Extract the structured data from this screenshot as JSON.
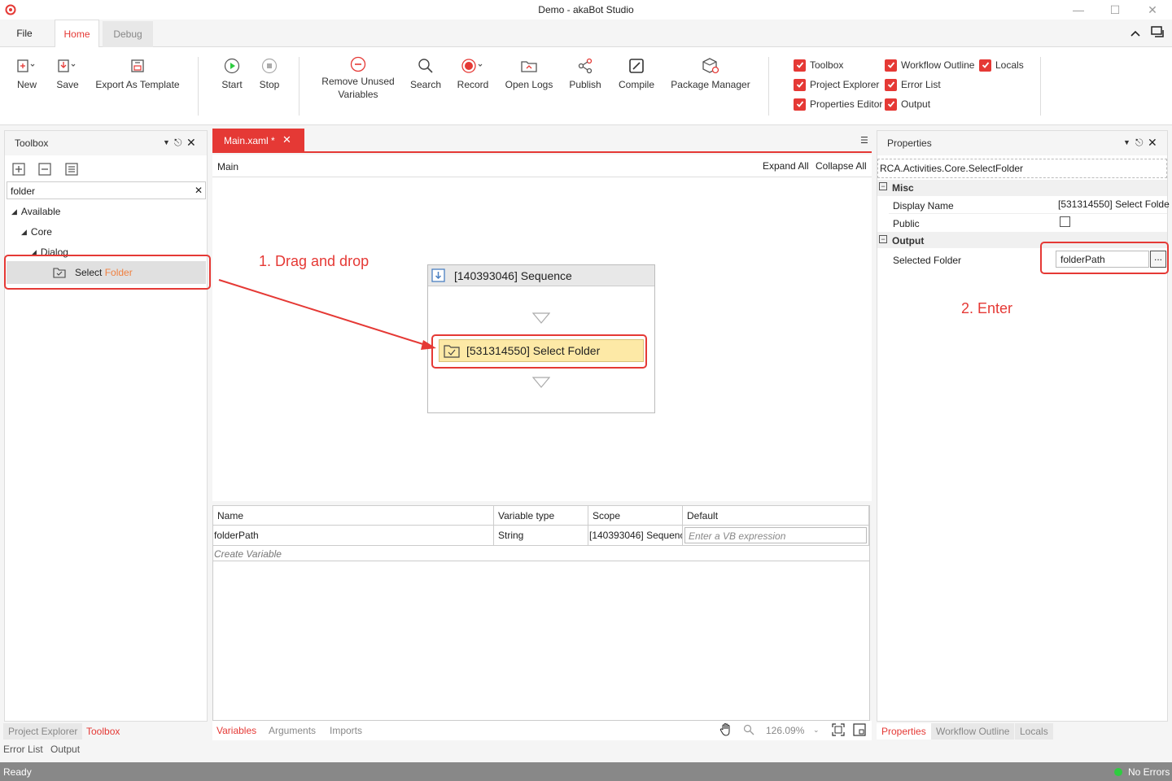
{
  "window": {
    "title": "Demo - akaBot Studio"
  },
  "ribbon_tabs": {
    "file": "File",
    "home": "Home",
    "debug": "Debug"
  },
  "ribbon": {
    "new": "New",
    "save": "Save",
    "export_template": "Export As Template",
    "start": "Start",
    "stop": "Stop",
    "remove_unused_1": "Remove Unused",
    "remove_unused_2": "Variables",
    "search": "Search",
    "record": "Record",
    "open_logs": "Open Logs",
    "publish": "Publish",
    "compile": "Compile",
    "package_manager": "Package Manager"
  },
  "panels_toggles": {
    "toolbox": "Toolbox",
    "workflow_outline": "Workflow Outline",
    "locals": "Locals",
    "project_explorer": "Project Explorer",
    "error_list": "Error List",
    "properties_editor": "Properties Editor",
    "output": "Output"
  },
  "toolbox": {
    "title": "Toolbox",
    "search_value": "folder",
    "tree": {
      "available": "Available",
      "core": "Core",
      "dialog": "Dialog",
      "item_prefix": "Select ",
      "item_highlight": "Folder"
    }
  },
  "designer": {
    "tab": "Main.xaml *",
    "breadcrumb": "Main",
    "expand_all": "Expand All",
    "collapse_all": "Collapse All",
    "sequence_title": "[140393046] Sequence",
    "activity_title": "[531314550] Select Folder",
    "annotation_1": "1. Drag and drop",
    "annotation_2": "2. Enter"
  },
  "variables": {
    "headers": [
      "Name",
      "Variable type",
      "Scope",
      "Default"
    ],
    "row": {
      "name": "folderPath",
      "type": "String",
      "scope": "[140393046] Sequence",
      "default_placeholder": "Enter a VB expression"
    },
    "create": "Create Variable",
    "tabs": {
      "variables": "Variables",
      "arguments": "Arguments",
      "imports": "Imports"
    },
    "zoom": "126.09%"
  },
  "properties": {
    "title": "Properties",
    "type_name": "RCA.Activities.Core.SelectFolder",
    "misc": "Misc",
    "display_name_label": "Display Name",
    "display_name_value": "[531314550] Select Folde",
    "public_label": "Public",
    "output": "Output",
    "selected_folder_label": "Selected Folder",
    "selected_folder_value": "folderPath",
    "browse": "..."
  },
  "bottom_tabs_left": {
    "project_explorer": "Project Explorer",
    "toolbox": "Toolbox",
    "error_list": "Error List",
    "output": "Output"
  },
  "bottom_tabs_right": {
    "properties": "Properties",
    "workflow_outline": "Workflow Outline",
    "locals": "Locals"
  },
  "status": {
    "left": "Ready",
    "right": "No Errors"
  },
  "colors": {
    "accent": "#e53935",
    "activity_fill": "#fde9a6",
    "status_ok": "#2ecc40"
  }
}
